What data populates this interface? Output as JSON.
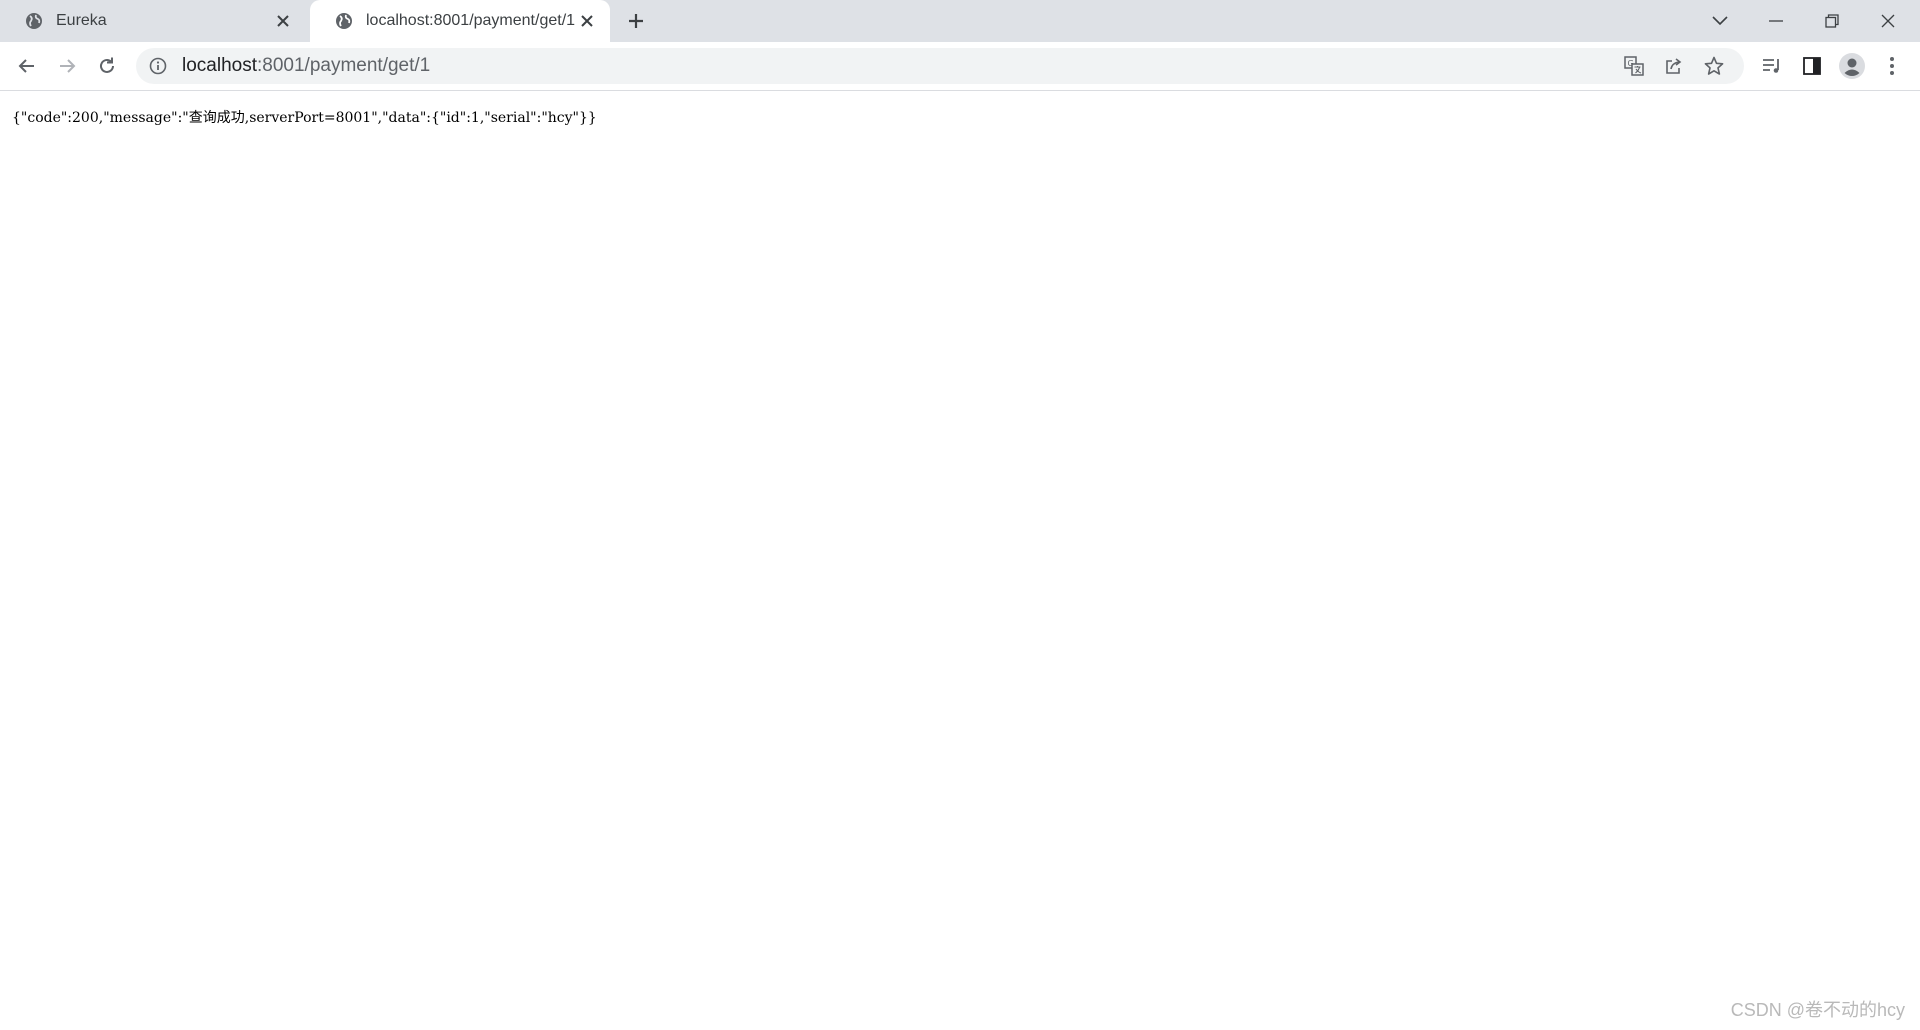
{
  "tabs": [
    {
      "title": "Eureka",
      "icon": "globe-icon",
      "active": false
    },
    {
      "title": "localhost:8001/payment/get/1",
      "icon": "globe-icon",
      "active": true
    }
  ],
  "address_bar": {
    "host": "localhost",
    "rest": ":8001/payment/get/1"
  },
  "page": {
    "json_text": "{\"code\":200,\"message\":\"查询成功,serverPort=8001\",\"data\":{\"id\":1,\"serial\":\"hcy\"}}"
  },
  "watermark": "CSDN @卷不动的hcy",
  "colors": {
    "tabstrip": "#dee1e6",
    "omnibox": "#f1f3f4",
    "icon": "#5f6368"
  }
}
